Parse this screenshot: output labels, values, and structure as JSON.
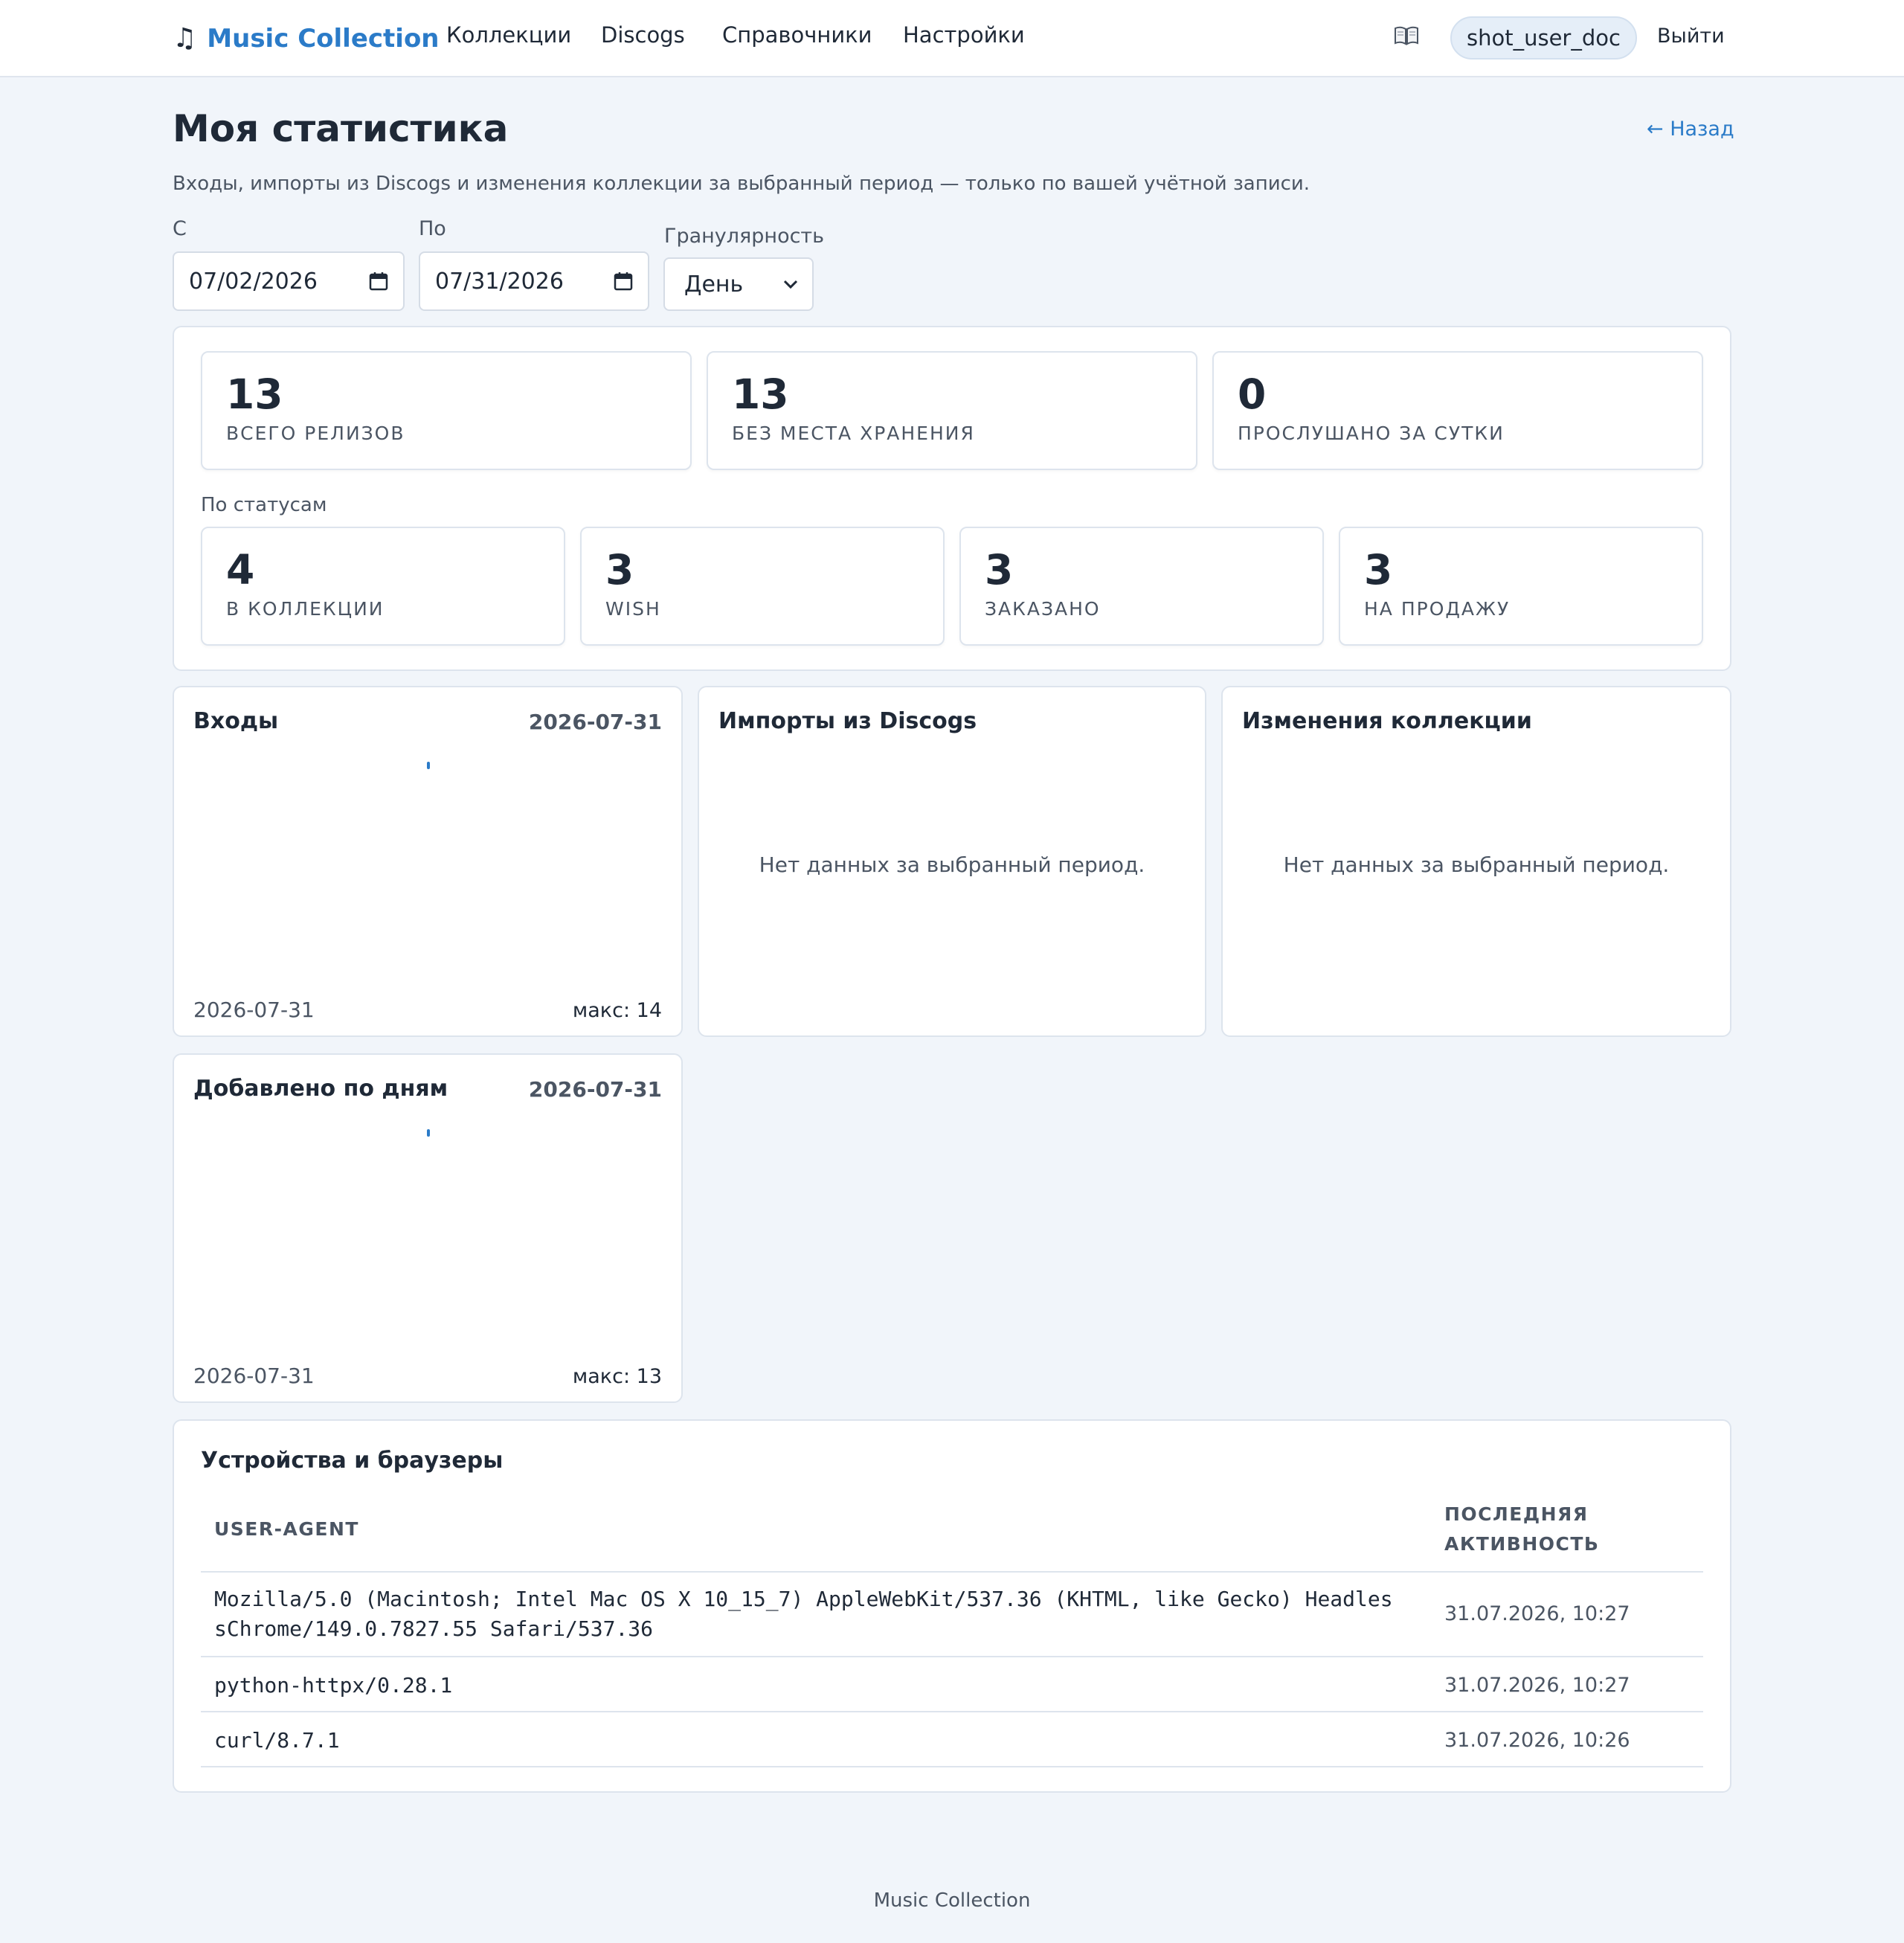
{
  "nav": {
    "brand": "Music Collection",
    "links": [
      "Коллекции",
      "Discogs",
      "Справочники",
      "Настройки"
    ],
    "username": "shot_user_doc",
    "logout": "Выйти"
  },
  "page": {
    "title": "Моя статистика",
    "back": "← Назад",
    "subtitle": "Входы, импорты из Discogs и изменения коллекции за выбранный период — только по вашей учётной записи."
  },
  "filters": {
    "from_label": "С",
    "from_value": "07/02/2026",
    "to_label": "По",
    "to_value": "07/31/2026",
    "granularity_label": "Гранулярность",
    "granularity_value": "День"
  },
  "stats": {
    "top": [
      {
        "value": "13",
        "label": "ВСЕГО РЕЛИЗОВ"
      },
      {
        "value": "13",
        "label": "БЕЗ МЕСТА ХРАНЕНИЯ"
      },
      {
        "value": "0",
        "label": "ПРОСЛУШАНО ЗА СУТКИ"
      }
    ],
    "by_status_label": "По статусам",
    "statuses": [
      {
        "value": "4",
        "label": "В КОЛЛЕКЦИИ"
      },
      {
        "value": "3",
        "label": "WISH"
      },
      {
        "value": "3",
        "label": "ЗАКАЗАНО"
      },
      {
        "value": "3",
        "label": "НА ПРОДАЖУ"
      }
    ]
  },
  "cards": {
    "logins": {
      "title": "Входы",
      "date": "2026-07-31",
      "foot_date": "2026-07-31",
      "max": "макс: 14"
    },
    "imports": {
      "title": "Импорты из Discogs",
      "empty": "Нет данных за выбранный период."
    },
    "changes": {
      "title": "Изменения коллекции",
      "empty": "Нет данных за выбранный период."
    },
    "added": {
      "title": "Добавлено по дням",
      "date": "2026-07-31",
      "foot_date": "2026-07-31",
      "max": "макс: 13"
    }
  },
  "chart_data": [
    {
      "type": "bar",
      "title": "Входы",
      "categories": [
        "2026-07-31"
      ],
      "values": [
        14
      ],
      "color": "#2b7bc8"
    },
    {
      "type": "bar",
      "title": "Добавлено по дням",
      "categories": [
        "2026-07-31"
      ],
      "values": [
        13
      ],
      "color": "#2b7bc8"
    }
  ],
  "devices": {
    "title": "Устройства и браузеры",
    "headers": [
      "USER-AGENT",
      "ПОСЛЕДНЯЯ АКТИВНОСТЬ"
    ],
    "rows": [
      {
        "ua": "Mozilla/5.0 (Macintosh; Intel Mac OS X 10_15_7) AppleWebKit/537.36 (KHTML, like Gecko) HeadlessChrome/149.0.7827.55 Safari/537.36",
        "time": "31.07.2026, 10:27"
      },
      {
        "ua": "python-httpx/0.28.1",
        "time": "31.07.2026, 10:27"
      },
      {
        "ua": "curl/8.7.1",
        "time": "31.07.2026, 10:26"
      }
    ]
  },
  "footer": "Music Collection",
  "colors": {
    "accent": "#2b7bc8",
    "background": "#f1f5fa",
    "border": "#dde4ed"
  }
}
